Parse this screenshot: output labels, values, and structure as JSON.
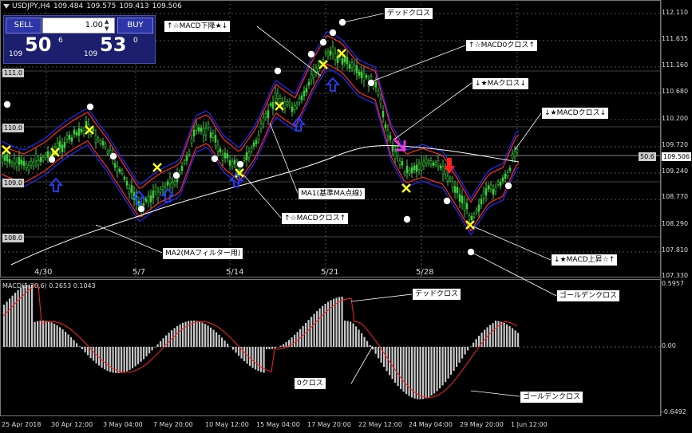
{
  "header": {
    "symbol": "USDJPY,H4",
    "open": "109.484",
    "high": "109.575",
    "low": "109.413",
    "close": "109.506"
  },
  "trade_panel": {
    "sell_label": "SELL",
    "buy_label": "BUY",
    "lot": "1.00",
    "sell_small": "109",
    "sell_big": "50",
    "sell_sup": "6",
    "buy_small": "109",
    "buy_big": "53",
    "buy_sup": "0"
  },
  "price_axis": [
    "112.110",
    "111.635",
    "111.160",
    "110.680",
    "110.200",
    "109.720",
    "109.240",
    "108.770",
    "108.290",
    "107.810",
    "107.330"
  ],
  "current_price": "109.506",
  "ma_value": "50.6",
  "left_levels": [
    "111.0",
    "110.0",
    "109.0",
    "108.0"
  ],
  "date_labels": [
    "4/30",
    "5/7",
    "5/14",
    "5/21",
    "5/28"
  ],
  "annotations": {
    "dead_cross": "デッドクロス",
    "macd_down": "↑☆MACD下降★↓",
    "macd0_cross": "↑☆MACD0クロス↑",
    "ma_cross": "↓★MAクロス↓",
    "macd_cross_down": "↓★MACDクロス↓",
    "ma1": "MA1(基準MA点線)",
    "macd_cross_up": "↑☆MACDクロス↑",
    "ma2": "MA2(MAフィルター用)",
    "macd_up": "↓★MACD上昇☆↑",
    "golden_cross": "ゴールデンクロス"
  },
  "macd_panel": {
    "label": "MACD(5,20,6) 0.2653 0.1043",
    "axis": [
      "0.5957",
      "0.00",
      "-0.6492"
    ],
    "annotations": {
      "dead_cross": "デッドクロス",
      "zero_cross": "0クロス",
      "golden_cross": "ゴールデンクロス"
    }
  },
  "time_axis": [
    "25 Apr 2018",
    "30 Apr 12:00",
    "3 May 04:00",
    "7 May 20:00",
    "10 May 12:00",
    "15 May 04:00",
    "17 May 20:00",
    "22 May 12:00",
    "24 May 04:00",
    "29 May 20:00",
    "1 Jun 12:00"
  ],
  "colors": {
    "candles": "#3ccc3c",
    "fast_line": "#ff2a2a",
    "slow_line": "#2626ff",
    "ma2": "#ffffff",
    "histogram": "#c8c8c8",
    "signal": "#ff2020",
    "marker_cross": "#ffff20",
    "arrow_up": "#2840ff",
    "arrow_down": "#ff2020",
    "grid": "#555555"
  },
  "chart_data": {
    "type": "line",
    "title": "USDJPY,H4",
    "ylim": [
      107.33,
      112.11
    ],
    "x": [
      "4/30",
      "5/7",
      "5/14",
      "5/21",
      "5/28"
    ],
    "series": [
      {
        "values": [
          109.4,
          109.1,
          109.6,
          110.9,
          109.6
        ]
      },
      {
        "values": [
          108.0,
          108.6,
          109.0,
          109.3,
          109.6
        ]
      }
    ]
  }
}
